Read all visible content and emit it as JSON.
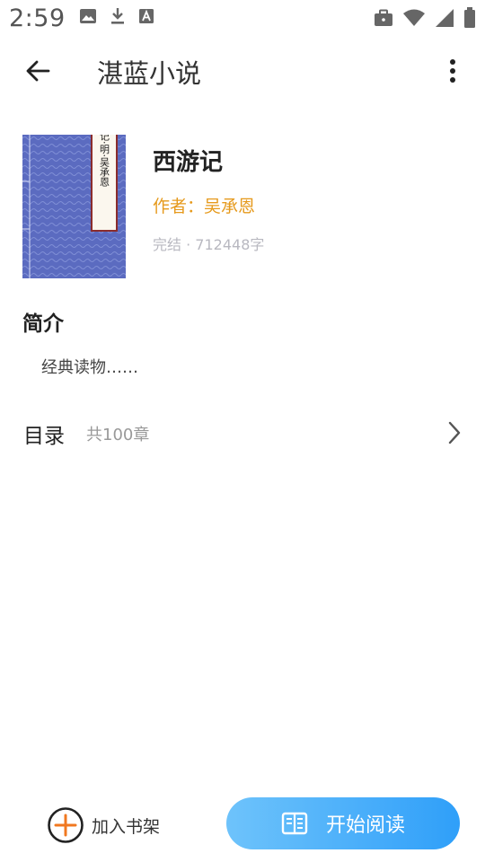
{
  "status_bar": {
    "time": "2:59",
    "left_icons": [
      "gallery-icon",
      "download-icon",
      "text-a-icon"
    ],
    "right_icons": [
      "briefcase-icon",
      "wifi-icon",
      "signal-icon",
      "battery-icon"
    ]
  },
  "app_bar": {
    "title": "湛蓝小说",
    "back_icon": "arrow-left-icon",
    "more_icon": "more-vertical-icon"
  },
  "book": {
    "cover_text": "西游记·明·吴承恩",
    "title": "西游记",
    "author_label": "作者：",
    "author_name": "吴承恩",
    "status": "完结",
    "separator": "·",
    "word_count": "712448字"
  },
  "intro": {
    "heading": "简介",
    "text": "经典读物……"
  },
  "catalog": {
    "label": "目录",
    "count": "共100章",
    "chevron_icon": "chevron-right-icon"
  },
  "bottom": {
    "add_shelf_label": "加入书架",
    "start_read_label": "开始阅读",
    "accent": "#2f9ff9",
    "add_icon_color": "#f07820"
  }
}
